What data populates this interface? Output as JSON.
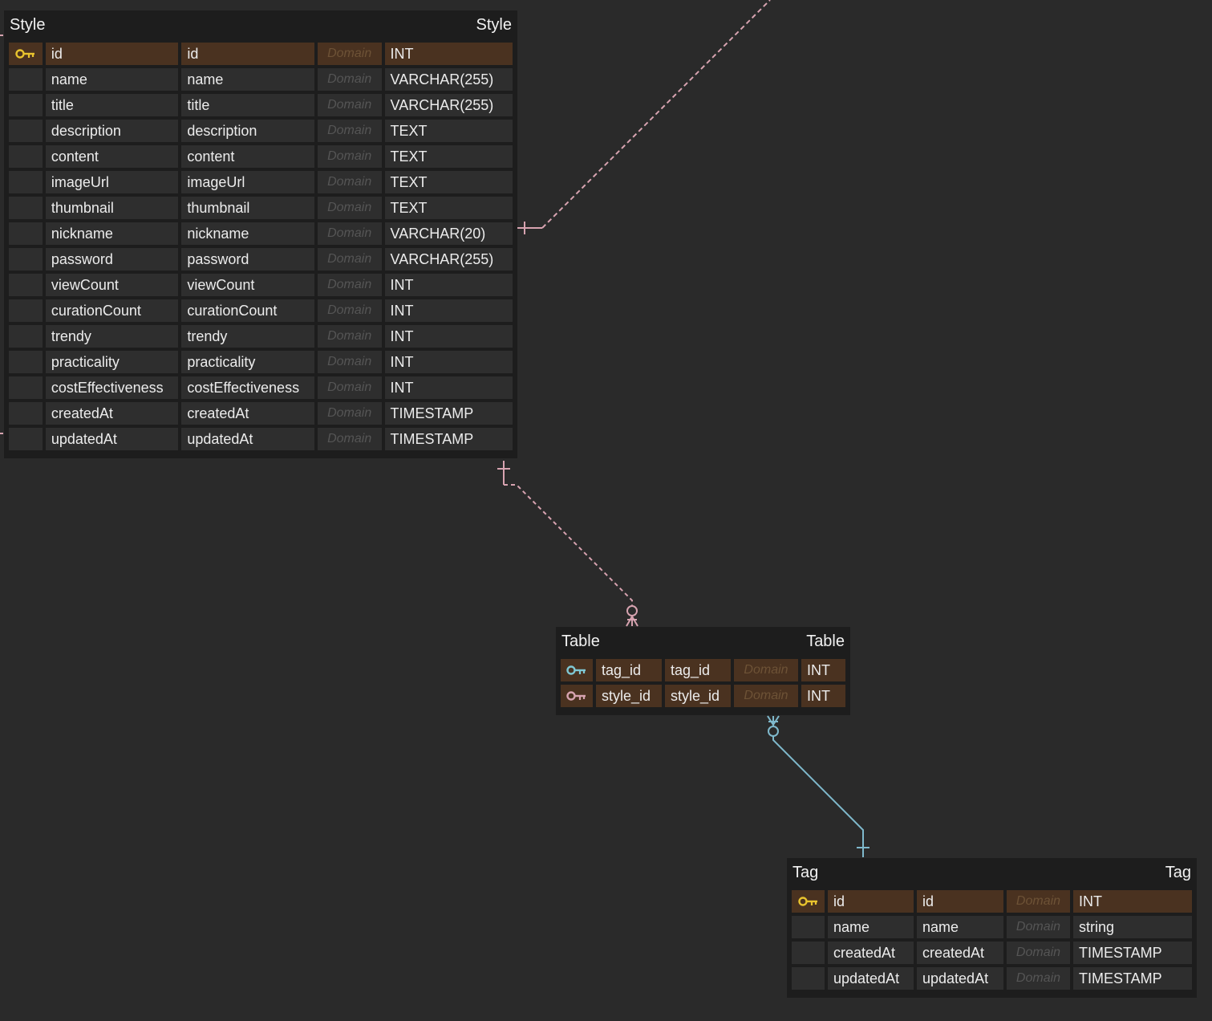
{
  "colors": {
    "background": "#2a2a2a",
    "table_bg": "#1d1d1d",
    "cell_bg": "#2e2e2e",
    "pk_cell_bg": "#4a3220",
    "pk_key": "#e8c32e",
    "fk_key_teal": "#7fc8d4",
    "fk_key_pink": "#d7a3b0",
    "link_pink": "#d7a3b0",
    "link_teal": "#7fb9cc"
  },
  "domain_placeholder": "Domain",
  "entities": {
    "style": {
      "title_left": "Style",
      "title_right": "Style",
      "columns": [
        {
          "key": "pk-icon",
          "logical": "id",
          "physical": "id",
          "type": "INT"
        },
        {
          "key": "",
          "logical": "name",
          "physical": "name",
          "type": "VARCHAR(255)"
        },
        {
          "key": "",
          "logical": "title",
          "physical": "title",
          "type": "VARCHAR(255)"
        },
        {
          "key": "",
          "logical": "description",
          "physical": "description",
          "type": "TEXT"
        },
        {
          "key": "",
          "logical": "content",
          "physical": "content",
          "type": "TEXT"
        },
        {
          "key": "",
          "logical": "imageUrl",
          "physical": "imageUrl",
          "type": "TEXT"
        },
        {
          "key": "",
          "logical": "thumbnail",
          "physical": "thumbnail",
          "type": "TEXT"
        },
        {
          "key": "",
          "logical": "nickname",
          "physical": "nickname",
          "type": "VARCHAR(20)"
        },
        {
          "key": "",
          "logical": "password",
          "physical": "password",
          "type": "VARCHAR(255)"
        },
        {
          "key": "",
          "logical": "viewCount",
          "physical": "viewCount",
          "type": "INT"
        },
        {
          "key": "",
          "logical": "curationCount",
          "physical": "curationCount",
          "type": "INT"
        },
        {
          "key": "",
          "logical": "trendy",
          "physical": "trendy",
          "type": "INT"
        },
        {
          "key": "",
          "logical": "practicality",
          "physical": "practicality",
          "type": "INT"
        },
        {
          "key": "",
          "logical": "costEffectiveness",
          "physical": "costEffectiveness",
          "type": "INT"
        },
        {
          "key": "",
          "logical": "createdAt",
          "physical": "createdAt",
          "type": "TIMESTAMP"
        },
        {
          "key": "",
          "logical": "updatedAt",
          "physical": "updatedAt",
          "type": "TIMESTAMP"
        }
      ]
    },
    "table": {
      "title_left": "Table",
      "title_right": "Table",
      "columns": [
        {
          "key": "pfk-icon-teal",
          "logical": "tag_id",
          "physical": "tag_id",
          "type": "INT"
        },
        {
          "key": "pfk-icon-pink",
          "logical": "style_id",
          "physical": "style_id",
          "type": "INT"
        }
      ]
    },
    "tag": {
      "title_left": "Tag",
      "title_right": "Tag",
      "columns": [
        {
          "key": "pk-icon",
          "logical": "id",
          "physical": "id",
          "type": "INT"
        },
        {
          "key": "",
          "logical": "name",
          "physical": "name",
          "type": "string"
        },
        {
          "key": "",
          "logical": "createdAt",
          "physical": "createdAt",
          "type": "TIMESTAMP"
        },
        {
          "key": "",
          "logical": "updatedAt",
          "physical": "updatedAt",
          "type": "TIMESTAMP"
        }
      ]
    }
  },
  "relationships": [
    {
      "from": "style",
      "to": "offscreen-top-right",
      "style": "dashed",
      "color": "pink",
      "end_marker": "one"
    },
    {
      "from": "style",
      "to": "table",
      "style": "dashed",
      "color": "pink",
      "start_marker": "one",
      "end_marker": "zero-or-many"
    },
    {
      "from": "tag",
      "to": "table",
      "style": "solid",
      "color": "teal",
      "start_marker": "one",
      "end_marker": "zero-or-many"
    }
  ]
}
